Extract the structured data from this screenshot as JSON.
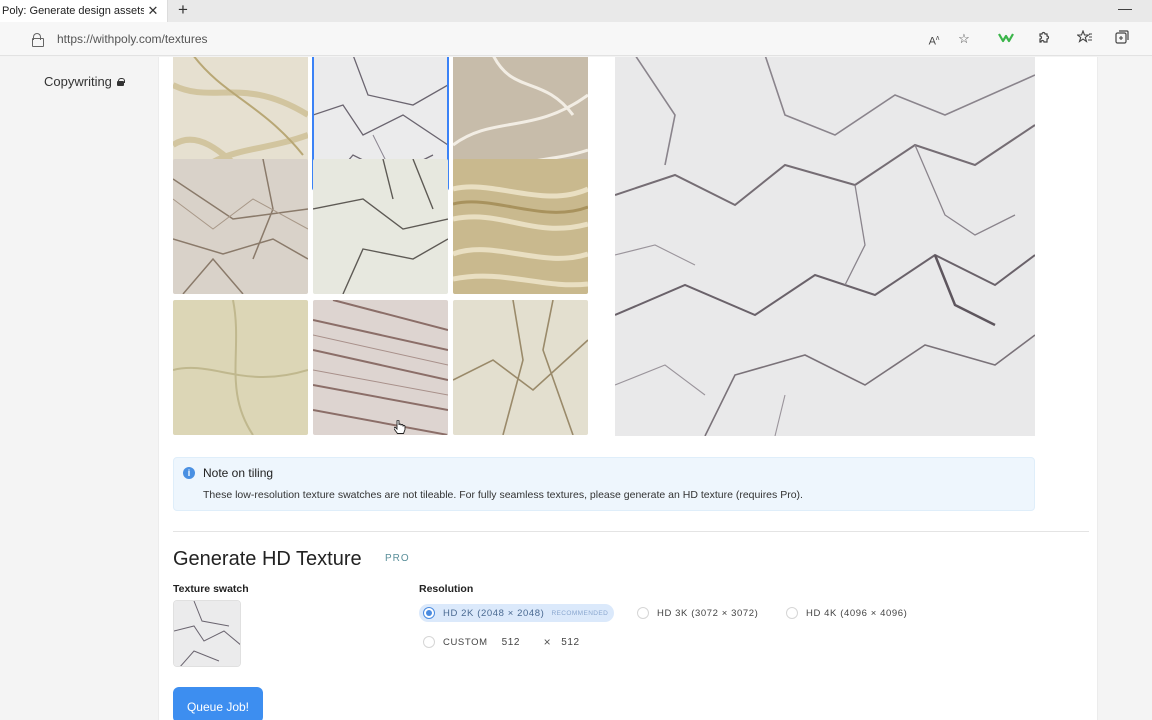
{
  "browser": {
    "tab_title": "Poly: Generate design assets with",
    "url": "https://withpoly.com/textures"
  },
  "sidebar": {
    "item_label": "Copywriting"
  },
  "note": {
    "title": "Note on tiling",
    "body": "These low-resolution texture swatches are not tileable. For fully seamless textures, please generate an HD texture (requires Pro)."
  },
  "generate": {
    "title": "Generate HD Texture",
    "pro_badge": "PRO",
    "swatch_label": "Texture swatch",
    "resolution_label": "Resolution",
    "options": [
      {
        "label": "HD 2K (2048 × 2048)",
        "tag": "RECOMMENDED",
        "selected": true
      },
      {
        "label": "HD 3K (3072 × 3072)",
        "selected": false
      },
      {
        "label": "HD 4K (4096 × 4096)",
        "selected": false
      }
    ],
    "custom": {
      "label": "CUSTOM",
      "width": "512",
      "times": "×",
      "height": "512"
    },
    "queue_button": "Queue Job!"
  },
  "colors": {
    "accent": "#3d8ef0",
    "note_bg": "#eef6fd",
    "selected_outline": "#3b82f6"
  }
}
